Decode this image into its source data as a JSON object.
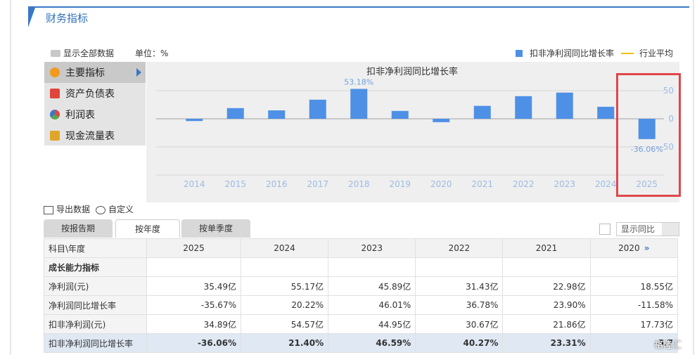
{
  "header": {
    "title": "财务指标"
  },
  "toolbar": {
    "show_all": "显示全部数据",
    "unit": "单位：%"
  },
  "legend": {
    "series": "扣非净利润同比增长率",
    "avg": "行业平均"
  },
  "menu": [
    {
      "label": "主要指标",
      "icon": "gear-icon",
      "color": "#f29a1e"
    },
    {
      "label": "资产负债表",
      "icon": "document-icon",
      "color": "#e0463c"
    },
    {
      "label": "利润表",
      "icon": "pie-icon",
      "color": "#5aa84e"
    },
    {
      "label": "现金流量表",
      "icon": "coins-icon",
      "color": "#e0a62a"
    }
  ],
  "chart_data": {
    "type": "bar",
    "title": "扣非净利润同比增长率",
    "categories": [
      "2014",
      "2015",
      "2016",
      "2017",
      "2018",
      "2019",
      "2020",
      "2021",
      "2022",
      "2023",
      "2024",
      "2025"
    ],
    "series": [
      {
        "name": "扣非净利润同比增长率",
        "values": [
          -4,
          19,
          15,
          34,
          53.18,
          14,
          -6,
          23,
          40.27,
          46.59,
          21.4,
          -36.06
        ],
        "color": "#4e90e6"
      }
    ],
    "data_labels": [
      {
        "category": "2018",
        "text": "53.18%"
      },
      {
        "category": "2025",
        "text": "-36.06%"
      }
    ],
    "yticks": [
      "50",
      "0",
      "-50"
    ],
    "ylim": [
      -100,
      100
    ]
  },
  "actions": {
    "export": "导出数据",
    "custom": "自定义"
  },
  "tabs": [
    "按报告期",
    "按年度",
    "按单季度"
  ],
  "yoy": {
    "label": "显示同比"
  },
  "table": {
    "corner": "科目\\年度",
    "years": [
      "2025",
      "2024",
      "2023",
      "2022",
      "2021",
      "2020"
    ],
    "rows": [
      {
        "name": "成长能力指标",
        "values": [
          "",
          "",
          "",
          "",
          "",
          ""
        ],
        "type": "group"
      },
      {
        "name": "净利润(元)",
        "values": [
          "35.49亿",
          "55.17亿",
          "45.89亿",
          "31.43亿",
          "22.98亿",
          "18.55亿"
        ],
        "type": ""
      },
      {
        "name": "净利润同比增长率",
        "values": [
          "-35.67%",
          "20.22%",
          "46.01%",
          "36.78%",
          "23.90%",
          "-11.58%"
        ],
        "type": ""
      },
      {
        "name": "扣非净利润(元)",
        "values": [
          "34.89亿",
          "54.57亿",
          "44.95亿",
          "30.67亿",
          "21.86亿",
          "17.73亿"
        ],
        "type": ""
      },
      {
        "name": "扣非净利润同比增长率",
        "values": [
          "-36.06%",
          "21.40%",
          "46.59%",
          "40.27%",
          "23.31%",
          "-5.7"
        ],
        "type": "hl"
      }
    ]
  },
  "watermark": "格隆汇"
}
